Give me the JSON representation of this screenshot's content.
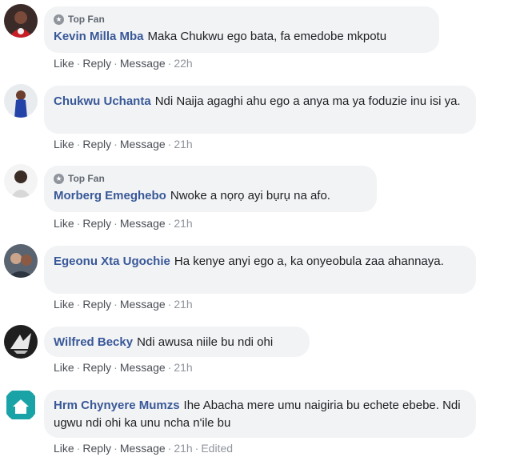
{
  "comments": [
    {
      "badge": "Top Fan",
      "author": "Kevin Milla Mba",
      "text": "Maka Chukwu ego bata, fa emedobe mkpotu",
      "like": "Like",
      "reply": "Reply",
      "message": "Message",
      "time": "22h",
      "edited": ""
    },
    {
      "badge": "",
      "author": "Chukwu Uchanta",
      "text": "Ndi Naija agaghi ahu ego a anya ma ya foduzie inu isi ya.",
      "like": "Like",
      "reply": "Reply",
      "message": "Message",
      "time": "21h",
      "edited": ""
    },
    {
      "badge": "Top Fan",
      "author": "Morberg Emeghebo",
      "text": "Nwoke a nọrọ ayi bụrụ na afo.",
      "like": "Like",
      "reply": "Reply",
      "message": "Message",
      "time": "21h",
      "edited": ""
    },
    {
      "badge": "",
      "author": "Egeonu Xta Ugochie",
      "text": "Ha kenye anyi ego a, ka onyeobula zaa ahannaya.",
      "like": "Like",
      "reply": "Reply",
      "message": "Message",
      "time": "21h",
      "edited": ""
    },
    {
      "badge": "",
      "author": "Wilfred Becky",
      "text": "Ndi awusa niile bu ndi ohi",
      "like": "Like",
      "reply": "Reply",
      "message": "Message",
      "time": "21h",
      "edited": ""
    },
    {
      "badge": "",
      "author": "Hrm Chynyere Mumzs",
      "text": "Ihe Abacha mere umu naigiria bu echete ebebe. Ndi ugwu ndi ohi ka unu ncha n'ile bu",
      "like": "Like",
      "reply": "Reply",
      "message": "Message",
      "time": "21h",
      "edited": "Edited"
    }
  ],
  "colors": {
    "author": "#385898",
    "bubble": "#f2f3f5",
    "meta": "#90949c"
  }
}
